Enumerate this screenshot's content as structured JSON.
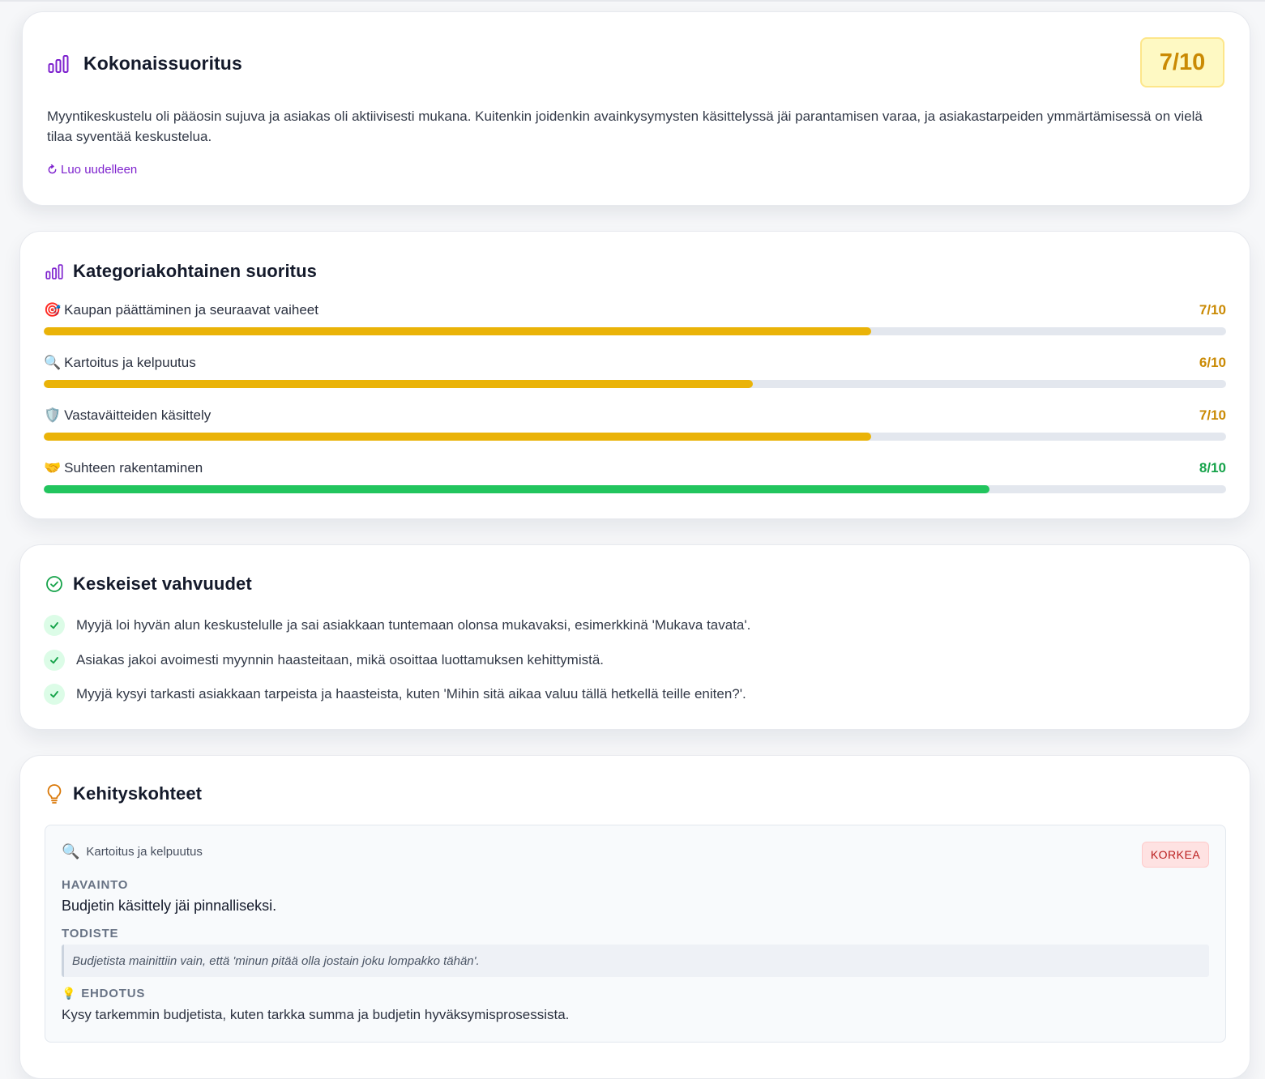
{
  "overall": {
    "title": "Kokonaissuoritus",
    "score": "7/10",
    "summary": "Myyntikeskustelu oli pääosin sujuva ja asiakas oli aktiivisesti mukana. Kuitenkin joidenkin avainkysymysten käsittelyssä jäi parantamisen varaa, ja asiakastarpeiden ymmärtämisessä on vielä tilaa syventää keskustelua.",
    "regenerate_label": "Luo uudelleen"
  },
  "categories": {
    "title": "Kategoriakohtainen suoritus",
    "items": [
      {
        "emoji": "🎯",
        "label": "Kaupan päättäminen ja seuraavat vaiheet",
        "score": "7/10",
        "value": 7,
        "max": 10,
        "color": "#eab308",
        "score_color": "#ca8a04"
      },
      {
        "emoji": "🔍",
        "label": "Kartoitus ja kelpuutus",
        "score": "6/10",
        "value": 6,
        "max": 10,
        "color": "#eab308",
        "score_color": "#ca8a04"
      },
      {
        "emoji": "🛡️",
        "label": "Vastaväitteiden käsittely",
        "score": "7/10",
        "value": 7,
        "max": 10,
        "color": "#eab308",
        "score_color": "#ca8a04"
      },
      {
        "emoji": "🤝",
        "label": "Suhteen rakentaminen",
        "score": "8/10",
        "value": 8,
        "max": 10,
        "color": "#22c55e",
        "score_color": "#16a34a"
      }
    ]
  },
  "strengths": {
    "title": "Keskeiset vahvuudet",
    "items": [
      "Myyjä loi hyvän alun keskustelulle ja sai asiakkaan tuntemaan olonsa mukavaksi, esimerkkinä 'Mukava tavata'.",
      "Asiakas jakoi avoimesti myynnin haasteitaan, mikä osoittaa luottamuksen kehittymistä.",
      "Myyjä kysyi tarkasti asiakkaan tarpeista ja haasteista, kuten 'Mihin sitä aikaa valuu tällä hetkellä teille eniten?'."
    ]
  },
  "improvements": {
    "title": "Kehityskohteet",
    "items": [
      {
        "category_emoji": "🔍",
        "category": "Kartoitus ja kelpuutus",
        "priority": "KORKEA",
        "finding_label": "HAVAINTO",
        "finding": "Budjetin käsittely jäi pinnalliseksi.",
        "evidence_label": "TODISTE",
        "evidence": "Budjetista mainittiin vain, että 'minun pitää olla jostain joku lompakko tähän'.",
        "suggestion_emoji": "💡",
        "suggestion_label": "EHDOTUS",
        "suggestion": "Kysy tarkemmin budjetista, kuten tarkka summa ja budjetin hyväksymisprosessista."
      }
    ]
  }
}
